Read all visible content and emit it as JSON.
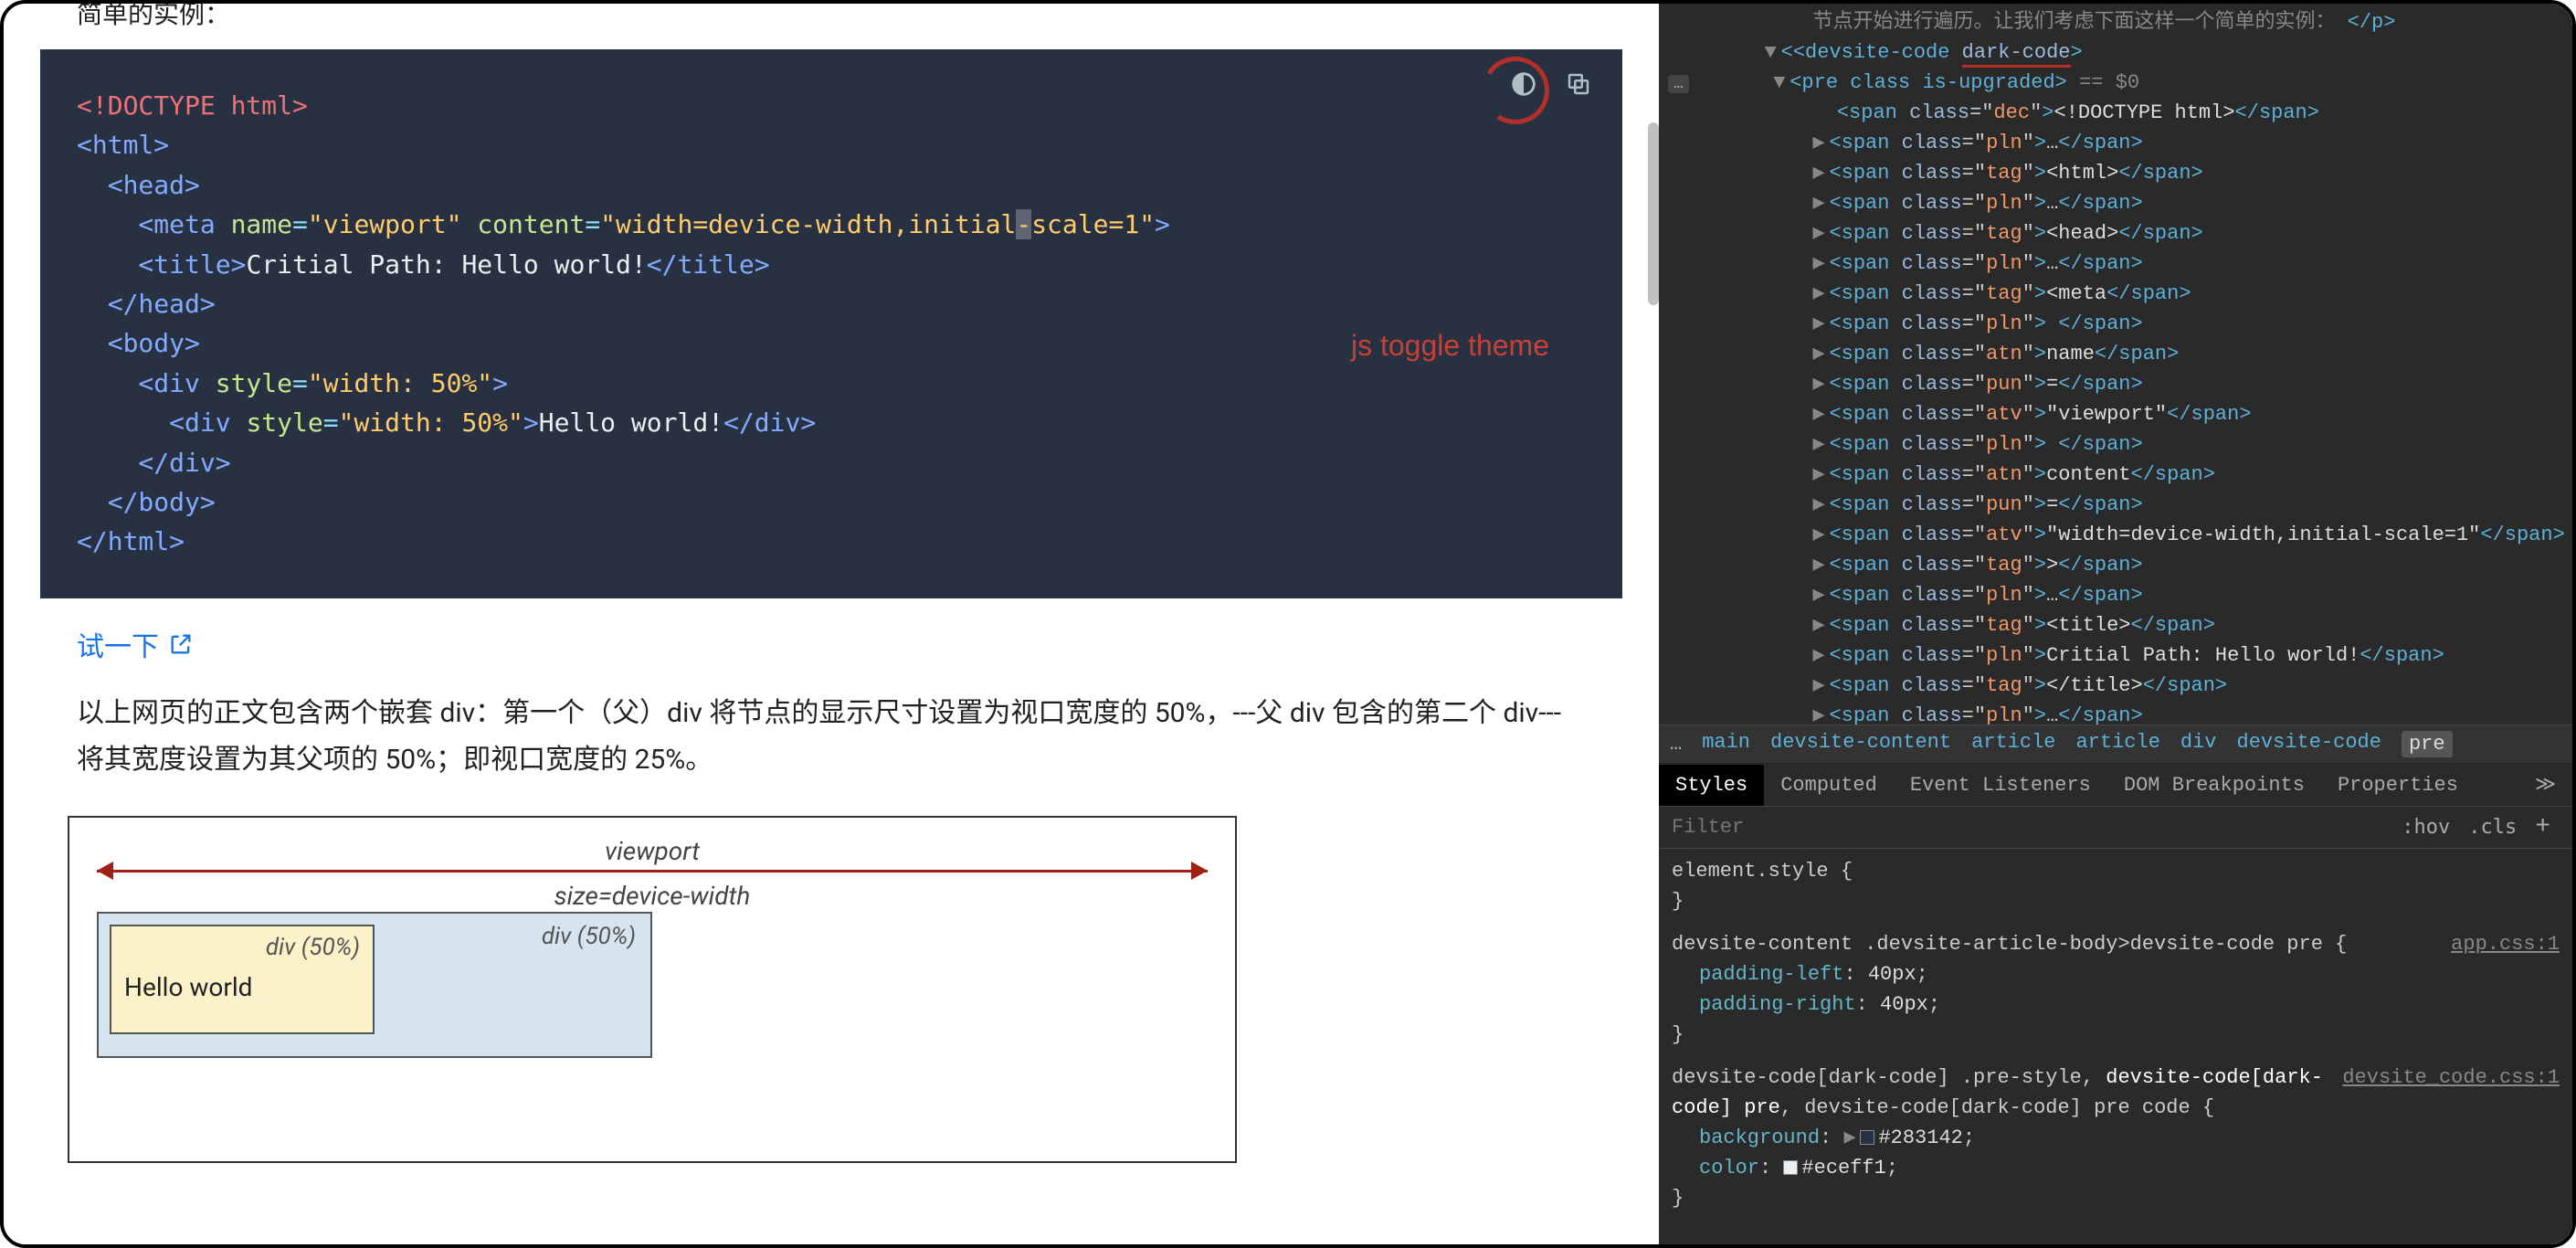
{
  "page": {
    "heading_fragment": "简单的实例：",
    "annotation_text": "js toggle theme",
    "try_link_text": "试一下",
    "body_paragraph": "以上网页的正文包含两个嵌套 div：第一个（父）div 将节点的显示尺寸设置为视口宽度的 50%，---父 div 包含的第二个 div---将其宽度设置为其父项的 50%；即视口宽度的 25%。",
    "diagram": {
      "viewport_line1": "viewport",
      "viewport_line2": "size=device-width",
      "outer_label": "div (50%)",
      "inner_label": "div (50%)",
      "hello": "Hello world"
    }
  },
  "code": {
    "l1a": "<!DOCTYPE html>",
    "l2a": "<html>",
    "l3a": "  <head>",
    "l4a": "    <meta ",
    "l4b": "name",
    "l4c": "=",
    "l4d": "\"viewport\"",
    "l4e": " content",
    "l4f": "=",
    "l4g": "\"width=device-width,initial",
    "l4h": "-",
    "l4i": "scale=1\"",
    "l4j": ">",
    "l5a": "    <title>",
    "l5b": "Critial Path: Hello world!",
    "l5c": "</title>",
    "l6a": "  </head>",
    "l7a": "  <body>",
    "l8a": "    <div ",
    "l8b": "style",
    "l8c": "=",
    "l8d": "\"width: 50%\"",
    "l8e": ">",
    "l9a": "      <div ",
    "l9b": "style",
    "l9c": "=",
    "l9d": "\"width: 50%\"",
    "l9e": ">",
    "l9f": "Hello world!",
    "l9g": "</div>",
    "l10a": "    </div>",
    "l11a": "  </body>",
    "l12a": "</html>"
  },
  "devtools": {
    "truncated_top": "节点开始进行遍历。让我们考虑下面这样一个简单的实例：",
    "dom": {
      "wrapper_open_a": "<devsite-code ",
      "wrapper_open_b": "dark-code",
      "wrapper_open_c": ">",
      "pre_open": "<pre class is-upgraded>",
      "pre_sel": " == $0",
      "spans": [
        {
          "cls": "dec",
          "txt": "<!DOCTYPE html>"
        },
        {
          "cls": "pln",
          "txt": "…"
        },
        {
          "cls": "tag",
          "txt": "<html>"
        },
        {
          "cls": "pln",
          "txt": "…"
        },
        {
          "cls": "tag",
          "txt": "<head>"
        },
        {
          "cls": "pln",
          "txt": "…"
        },
        {
          "cls": "tag",
          "txt": "<meta"
        },
        {
          "cls": "pln",
          "txt": " "
        },
        {
          "cls": "atn",
          "txt": "name"
        },
        {
          "cls": "pun",
          "txt": "="
        },
        {
          "cls": "atv",
          "txt": "\"viewport\""
        },
        {
          "cls": "pln",
          "txt": " "
        },
        {
          "cls": "atn",
          "txt": "content"
        },
        {
          "cls": "pun",
          "txt": "="
        },
        {
          "cls": "atv",
          "txt": "\"width=device-width,initial-scale=1\""
        },
        {
          "cls": "tag",
          "txt": ">"
        },
        {
          "cls": "pln",
          "txt": "…"
        },
        {
          "cls": "tag",
          "txt": "<title>"
        },
        {
          "cls": "pln",
          "txt": "Critial Path: Hello world!"
        },
        {
          "cls": "tag",
          "txt": "</title>"
        },
        {
          "cls": "pln",
          "txt": "…"
        }
      ]
    },
    "breadcrumb": [
      "main",
      "devsite-content",
      "article",
      "article",
      "div",
      "devsite-code",
      "pre"
    ],
    "tabs": [
      "Styles",
      "Computed",
      "Event Listeners",
      "DOM Breakpoints",
      "Properties"
    ],
    "filter_placeholder": "Filter",
    "filter_hov": ":hov",
    "filter_cls": ".cls",
    "rules": {
      "r0_sel": "element.style {",
      "r0_close": "}",
      "r1_sel": "devsite-content .devsite-article-body>devsite-code pre {",
      "r1_origin": "app.css:1",
      "r1_p1n": "padding-left",
      "r1_p1v": "40px",
      "r1_p2n": "padding-right",
      "r1_p2v": "40px",
      "r1_close": "}",
      "r2_sel_a": "devsite-code[dark-code] .pre-style, ",
      "r2_sel_b": "devsite-code[dark-code] pre",
      "r2_sel_c": ", devsite-code[dark-code] pre code {",
      "r2_origin": "devsite_code.css:1",
      "r2_p1n": "background",
      "r2_p1v": "#283142",
      "r2_p2n": "color",
      "r2_p2v": "#eceff1",
      "r2_close": "}"
    }
  }
}
